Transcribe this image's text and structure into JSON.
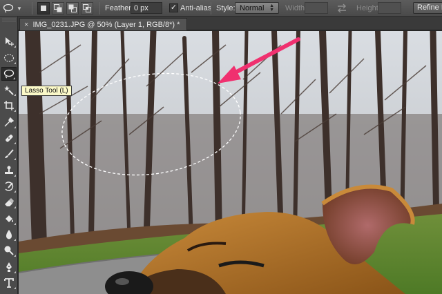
{
  "options_bar": {
    "tool_preset_icon": "lasso-icon",
    "selection_modes": [
      "new-selection-icon",
      "add-to-selection-icon",
      "subtract-from-selection-icon",
      "intersect-selection-icon"
    ],
    "feather_label": "Feather:",
    "feather_value": "0 px",
    "anti_alias_label": "Anti-alias",
    "anti_alias_checked": true,
    "style_label": "Style:",
    "style_value": "Normal",
    "width_label": "Width:",
    "width_value": "",
    "swap_icon": "swap-arrows-icon",
    "height_label": "Height:",
    "height_value": "",
    "refine_label": "Refine Edge..."
  },
  "document_tab": {
    "close_glyph": "×",
    "title": "IMG_0231.JPG @ 50% (Layer 1, RGB/8*) *"
  },
  "tools": [
    "move-tool-icon",
    "elliptical-marquee-tool-icon",
    "lasso-tool-icon",
    "quick-selection-tool-icon",
    "crop-tool-icon",
    "eyedropper-tool-icon",
    "spot-healing-brush-icon",
    "brush-tool-icon",
    "clone-stamp-tool-icon",
    "history-brush-icon",
    "eraser-tool-icon",
    "paint-bucket-icon",
    "blur-tool-icon",
    "dodge-tool-icon",
    "pen-tool-icon",
    "type-tool-icon"
  ],
  "active_tool": "lasso-tool-icon",
  "tooltip": "Lasso Tool (L)",
  "colors": {
    "annotation_arrow": "#f0306f",
    "selection_marquee": "#ffffff",
    "panel_bg": "#4b4b4b",
    "options_bg": "#535353"
  },
  "canvas_image": "photo of a leafless forest with a gravel path and grass; a brown dog's head in the lower right; an elliptical lasso selection marquee over the trees, pointed to by a pink arrow"
}
